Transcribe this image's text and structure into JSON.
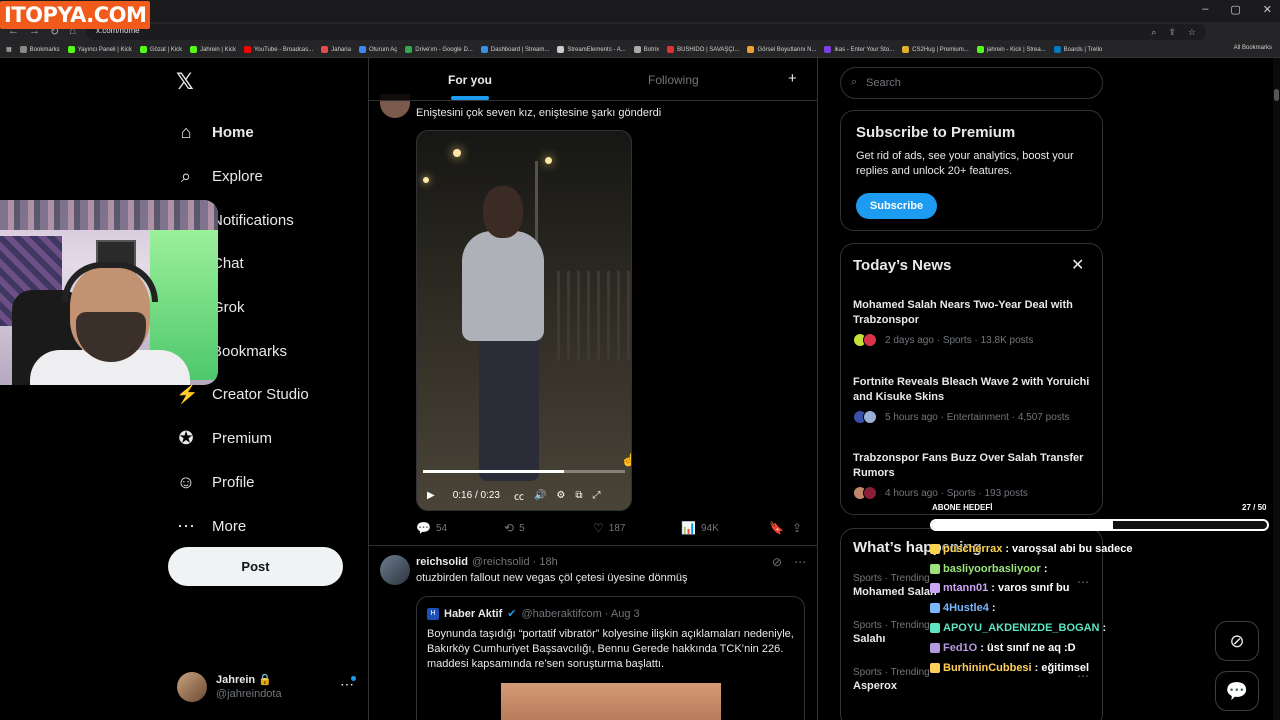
{
  "watermark": "ITOPYA.COM",
  "browser": {
    "url": "x.com/home",
    "new_tab": "+",
    "window_controls": [
      "–",
      "▢",
      "✕"
    ],
    "bookmarks": [
      {
        "label": "Bookmarks",
        "color": "#888888"
      },
      {
        "label": "Yayıncı Paneli | Kick",
        "color": "#53fc18"
      },
      {
        "label": "Gözat | Kick",
        "color": "#53fc18"
      },
      {
        "label": "Jahrein | Kick",
        "color": "#53fc18"
      },
      {
        "label": "YouTube - Broadcas...",
        "color": "#ff0000"
      },
      {
        "label": "Jaharia",
        "color": "#e84b4b"
      },
      {
        "label": "Oturum Aç",
        "color": "#4285f4"
      },
      {
        "label": "Drive'ım - Google D...",
        "color": "#34a853"
      },
      {
        "label": "Dashboard | Stream...",
        "color": "#3a8ee6"
      },
      {
        "label": "StreamElements - A...",
        "color": "#cccccc"
      },
      {
        "label": "Botrix",
        "color": "#aaaaaa"
      },
      {
        "label": "BUSHIDO | SAVAŞÇI...",
        "color": "#d33"
      },
      {
        "label": "Görsel Boyutlarını N...",
        "color": "#f0a030"
      },
      {
        "label": "ikas - Enter Your Sto...",
        "color": "#7b3fe4"
      },
      {
        "label": "CS2Hug | Premium...",
        "color": "#e0b030"
      },
      {
        "label": "jahrein - Kick | Strea...",
        "color": "#53fc18"
      },
      {
        "label": "Boards | Trello",
        "color": "#0079bf"
      }
    ],
    "all_bookmarks": "All Bookmarks"
  },
  "nav": {
    "items": [
      {
        "label": "Home",
        "icon": "⌂",
        "name": "home"
      },
      {
        "label": "Explore",
        "icon": "⌕",
        "name": "explore"
      },
      {
        "label": "Notifications",
        "icon": "🔔",
        "name": "notifications"
      },
      {
        "label": "Chat",
        "icon": "✉",
        "name": "chat"
      },
      {
        "label": "Grok",
        "icon": "◪",
        "name": "grok"
      },
      {
        "label": "Bookmarks",
        "icon": "⚑",
        "name": "bookmarks"
      },
      {
        "label": "Creator Studio",
        "icon": "⚡",
        "name": "creator-studio"
      },
      {
        "label": "Premium",
        "icon": "✪",
        "name": "premium"
      },
      {
        "label": "Profile",
        "icon": "☺",
        "name": "profile"
      },
      {
        "label": "More",
        "icon": "⋯",
        "name": "more"
      }
    ],
    "post_label": "Post",
    "account": {
      "name": "Jahrein 🔒",
      "handle": "@jahreindota"
    }
  },
  "feed": {
    "tabs": {
      "for_you": "For you",
      "following": "Following"
    },
    "tweet1": {
      "text": "Eniştesini çok seven kız, eniştesine şarkı gönderdi",
      "video": {
        "time": "0:16 / 0:23",
        "progress": 0.7
      },
      "stats": {
        "replies": "54",
        "reposts": "5",
        "likes": "187",
        "views": "94K"
      }
    },
    "tweet2": {
      "name": "reichsolid",
      "handle": "@reichsolid · 18h",
      "text": "otuzbirden fallout new vegas çöl çetesi üyesine dönmüş",
      "quote": {
        "name": "Haber Aktif",
        "handle": "@haberaktifcom · Aug 3",
        "text": "Boynunda taşıdığı “portatif vibratör” kolyesine ilişkin açıklamaları nedeniyle, Bakırköy Cumhuriyet Başsavcılığı, Bennu Gerede hakkında TCK’nin 226. maddesi kapsamında re’sen soruşturma başlattı."
      }
    }
  },
  "right": {
    "search_placeholder": "Search",
    "premium": {
      "title": "Subscribe to Premium",
      "desc": "Get rid of ads, see your analytics, boost your replies and unlock 20+ features.",
      "button": "Subscribe"
    },
    "news": {
      "title": "Today’s News",
      "items": [
        {
          "headline": "Mohamed Salah Nears Two-Year Deal with Trabzonspor",
          "meta": "2 days ago · Sports · 13.8K posts",
          "colors": [
            "#c6e03a",
            "#d8344a"
          ]
        },
        {
          "headline": "Fortnite Reveals Bleach Wave 2 with Yoruichi and Kisuke Skins",
          "meta": "5 hours ago · Entertainment · 4,507 posts",
          "colors": [
            "#3a4fa8",
            "#9ab0d8"
          ]
        },
        {
          "headline": "Trabzonspor Fans Buzz Over Salah Transfer Rumors",
          "meta": "4 hours ago · Sports · 193 posts",
          "colors": [
            "#c2876a",
            "#8a1f3a"
          ]
        }
      ]
    },
    "happening": {
      "title": "What’s happening",
      "trends": [
        {
          "cat": "Sports · Trending",
          "name": "Mohamed Salah"
        },
        {
          "cat": "Sports · Trending",
          "name": "Salahı"
        },
        {
          "cat": "Sports · Trending",
          "name": "Asperox"
        }
      ]
    }
  },
  "overlay": {
    "goal_label": "ABONE HEDEFİ",
    "goal_count": "27 / 50",
    "goal_progress": 0.54,
    "chat": [
      {
        "user": "puscherrax",
        "msg": ": varoşsal abi bu sadece",
        "color": "#ffd34d"
      },
      {
        "user": "basliyoorbasliyoor",
        "msg": ":",
        "color": "#9be37a"
      },
      {
        "user": "mtann01",
        "msg": ": varos sınıf bu",
        "color": "#c9a7f5"
      },
      {
        "user": "4Hustle4",
        "msg": ":",
        "color": "#7ab8ff"
      },
      {
        "user": "APOYU_AKDENIZDE_BOGAN",
        "msg": ":",
        "color": "#5fe3c0"
      },
      {
        "user": "Fed1O",
        "msg": ": üst sınıf ne aq :D",
        "color": "#b39ae0"
      },
      {
        "user": "BurhininCubbesi",
        "msg": ": eğitimsel",
        "color": "#ffcf5a"
      }
    ]
  }
}
